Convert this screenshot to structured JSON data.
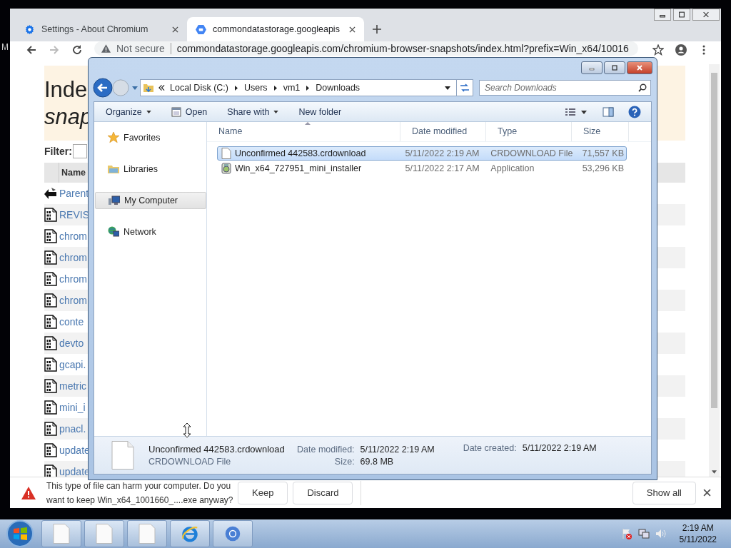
{
  "desktop_text": "M",
  "browser": {
    "tabs": [
      {
        "title": "Settings - About Chromium",
        "selected": false
      },
      {
        "title": "commondatastorage.googleapis",
        "selected": true
      }
    ],
    "address": {
      "security": "Not secure",
      "url": "commondatastorage.googleapis.com/chromium-browser-snapshots/index.html?prefix=Win_x64/10016"
    }
  },
  "page": {
    "heading_1": "Inde",
    "heading_2": "snap",
    "filter_label": "Filter:",
    "column": "Name",
    "rows": [
      {
        "kind": "parent",
        "name": "Parent"
      },
      {
        "kind": "file",
        "name": "REVIS"
      },
      {
        "kind": "file",
        "name": "chrom"
      },
      {
        "kind": "file",
        "name": "chrom"
      },
      {
        "kind": "file",
        "name": "chrom"
      },
      {
        "kind": "file",
        "name": "chrom"
      },
      {
        "kind": "file",
        "name": "conte"
      },
      {
        "kind": "file",
        "name": "devto"
      },
      {
        "kind": "file",
        "name": "gcapi."
      },
      {
        "kind": "file",
        "name": "metric"
      },
      {
        "kind": "file",
        "name": "mini_i"
      },
      {
        "kind": "file",
        "name": "pnacl."
      },
      {
        "kind": "file",
        "name": "update"
      },
      {
        "kind": "file",
        "name": "update"
      }
    ]
  },
  "download_bar": {
    "message": "This type of file can harm your computer. Do you want to keep Win_x64_1001660_....exe anyway?",
    "buttons": [
      "Keep",
      "Discard"
    ],
    "show_all": "Show all"
  },
  "explorer": {
    "breadcrumb": [
      "Local Disk (C:)",
      "Users",
      "vm1",
      "Downloads"
    ],
    "search_placeholder": "Search Downloads",
    "commands": [
      {
        "label": "Organize",
        "kind": "menu"
      },
      {
        "label": "Open",
        "kind": "open"
      },
      {
        "label": "Share with",
        "kind": "menu"
      },
      {
        "label": "New folder",
        "kind": "plain"
      }
    ],
    "nav": [
      {
        "label": "Favorites",
        "kind": "favorites",
        "selected": false
      },
      {
        "label": "Libraries",
        "kind": "libraries",
        "selected": false
      },
      {
        "label": "My Computer",
        "kind": "computer",
        "selected": true
      },
      {
        "label": "Network",
        "kind": "network",
        "selected": false
      }
    ],
    "columns": [
      "Name",
      "Date modified",
      "Type",
      "Size"
    ],
    "files": [
      {
        "name": "Unconfirmed 442583.crdownload",
        "date": "5/11/2022 2:19 AM",
        "type": "CRDOWNLOAD File",
        "size": "71,557 KB",
        "kind": "blank",
        "selected": true
      },
      {
        "name": "Win_x64_727951_mini_installer",
        "date": "5/11/2022 2:17 AM",
        "type": "Application",
        "size": "53,296 KB",
        "kind": "installer",
        "selected": false
      }
    ],
    "details": {
      "name": "Unconfirmed 442583.crdownload",
      "type": "CRDOWNLOAD File",
      "modified_label": "Date modified:",
      "modified": "5/11/2022 2:19 AM",
      "size_label": "Size:",
      "size": "69.8 MB",
      "created_label": "Date created:",
      "created": "5/11/2022 2:19 AM"
    }
  },
  "taskbar": {
    "apps": [
      {
        "kind": "document"
      },
      {
        "kind": "document"
      },
      {
        "kind": "document"
      },
      {
        "kind": "ie"
      },
      {
        "kind": "chromium"
      }
    ],
    "time": "2:19 AM",
    "date": "5/11/2022"
  }
}
